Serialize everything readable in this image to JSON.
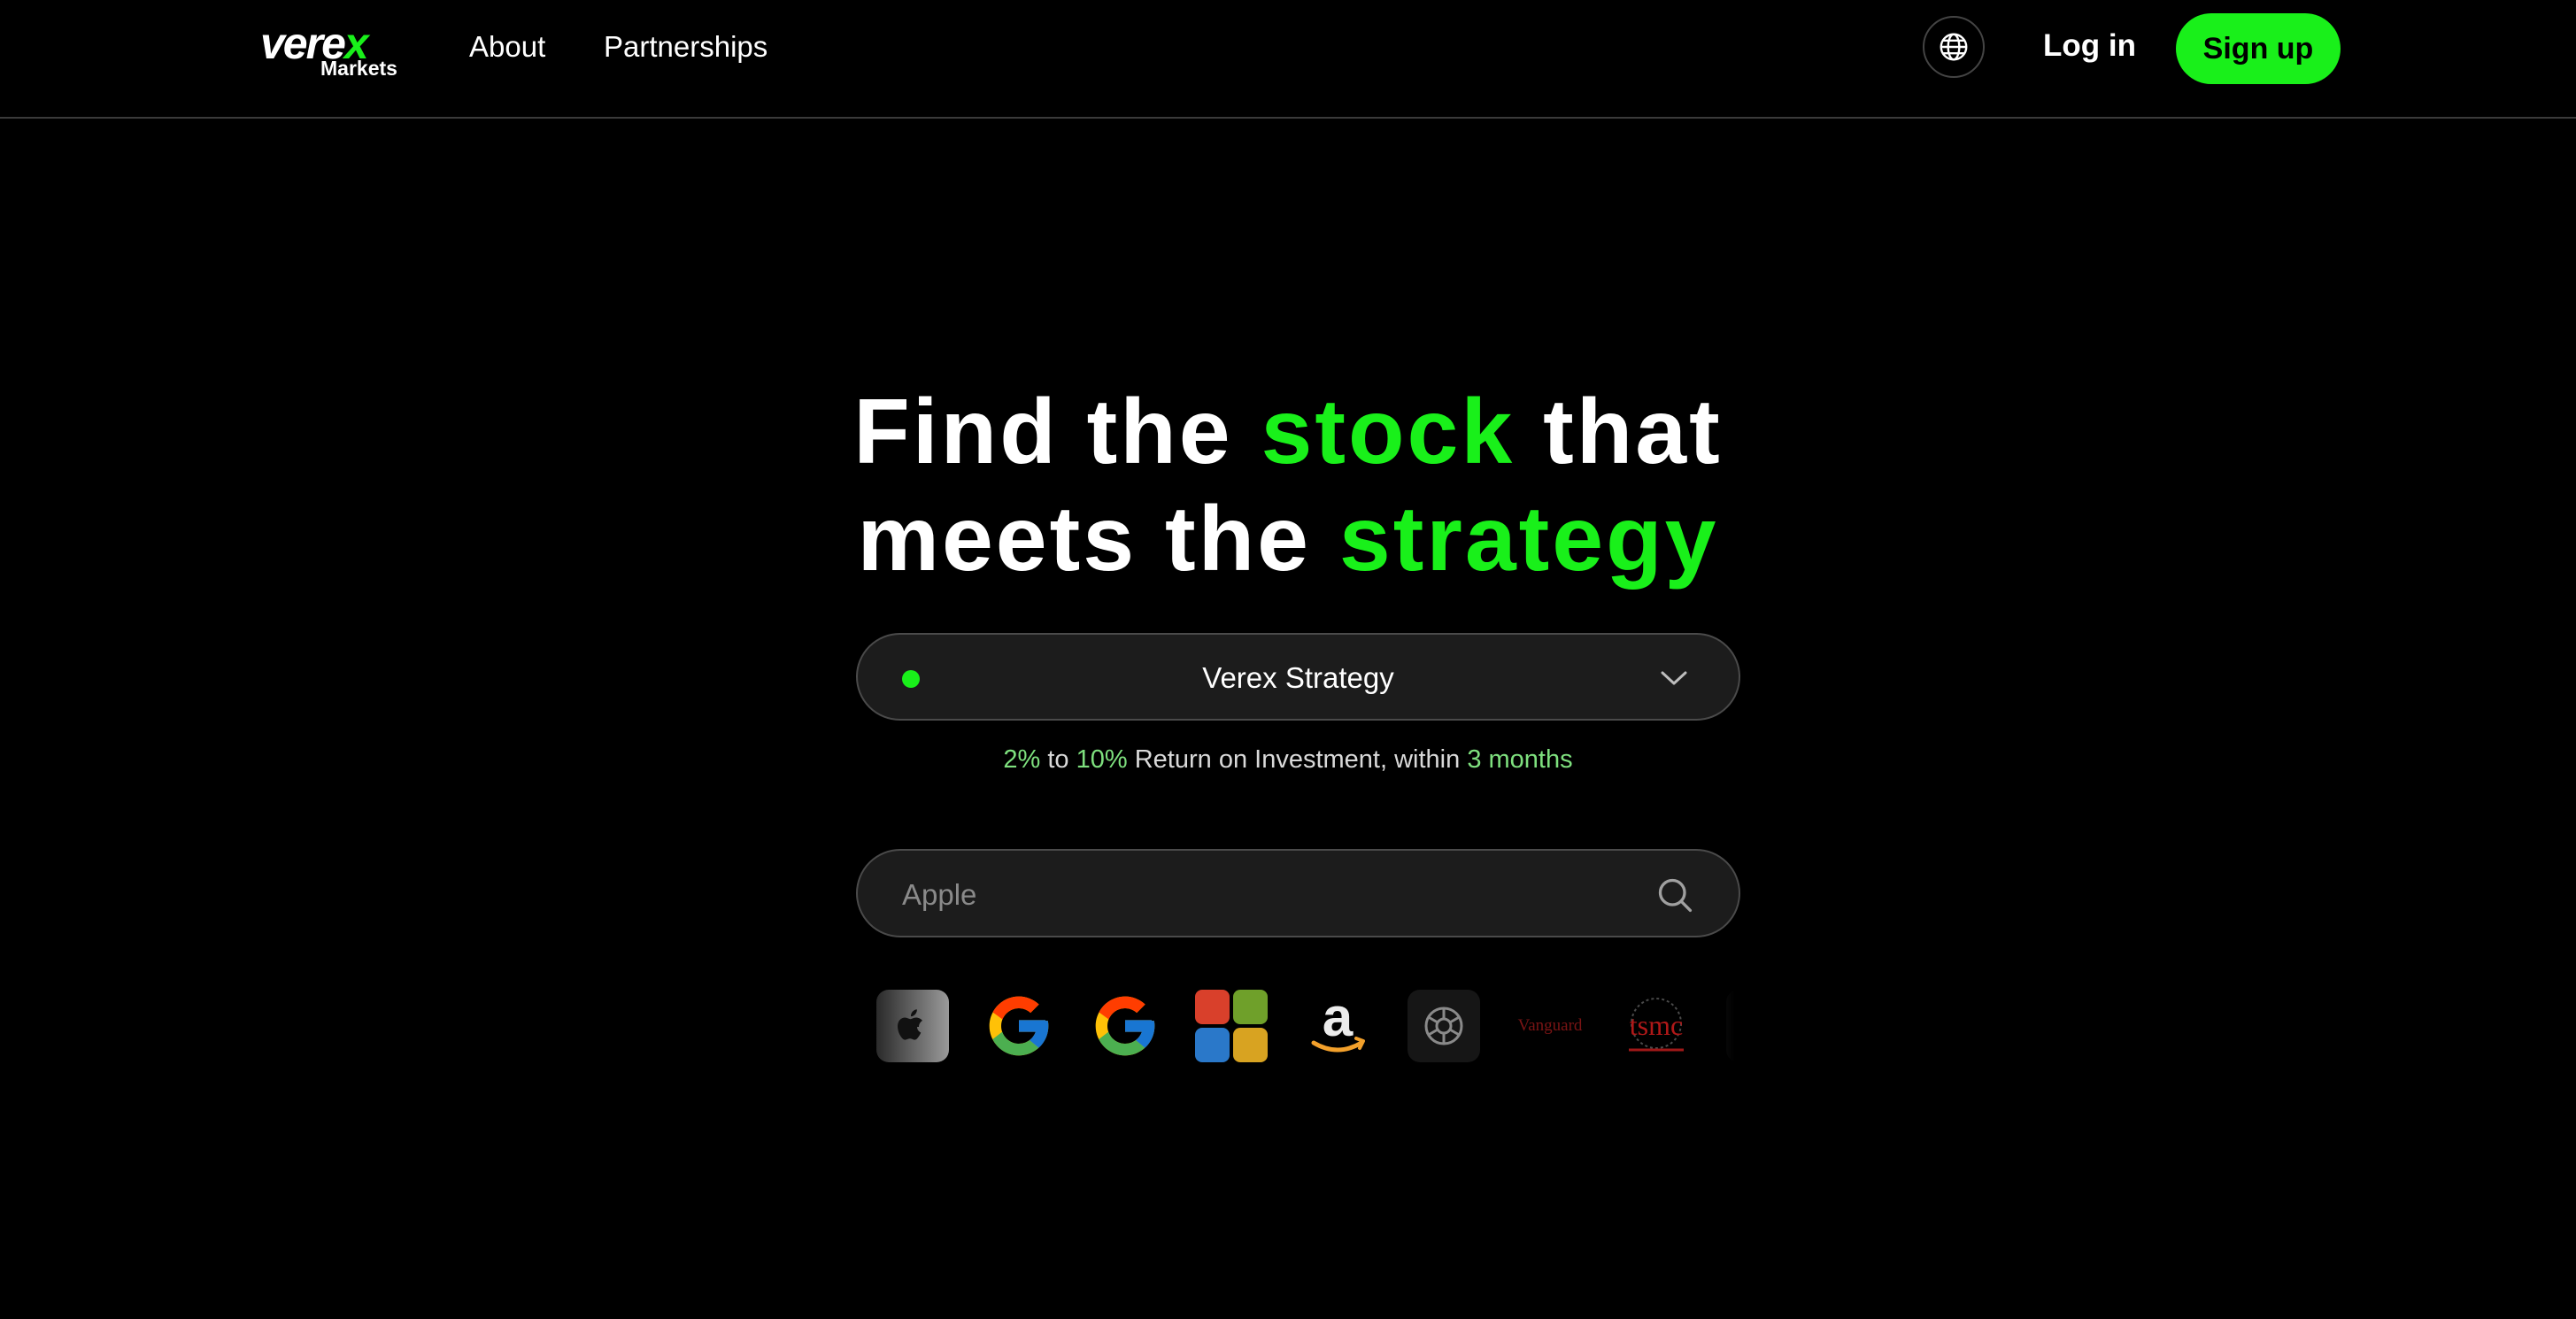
{
  "brand": {
    "logo_word": "vere",
    "logo_x": "x",
    "logo_sub": "Markets",
    "accent_color": "#19f01a"
  },
  "nav": {
    "about": "About",
    "partnerships": "Partnerships"
  },
  "header_actions": {
    "language_icon": "globe-icon",
    "login": "Log in",
    "signup": "Sign up"
  },
  "hero": {
    "line1_a": "Find the ",
    "line1_accent": "stock",
    "line1_b": " that",
    "line2_a": "meets the ",
    "line2_accent": "strategy"
  },
  "strategy_select": {
    "selected": "Verex Strategy",
    "status_color": "#19f01a"
  },
  "roi": {
    "min": "2%",
    "to": " to ",
    "max": "10%",
    "middle": " Return on Investment, within ",
    "period": "3 months"
  },
  "search": {
    "placeholder": "Apple",
    "icon": "search-icon"
  },
  "companies": [
    {
      "name": "apple-logo"
    },
    {
      "name": "google-logo"
    },
    {
      "name": "google-logo"
    },
    {
      "name": "microsoft-logo"
    },
    {
      "name": "amazon-logo"
    },
    {
      "name": "openai-logo"
    },
    {
      "name": "vanguard-logo",
      "text": "Vanguard"
    },
    {
      "name": "tsmc-logo",
      "text": "tsmc"
    }
  ]
}
